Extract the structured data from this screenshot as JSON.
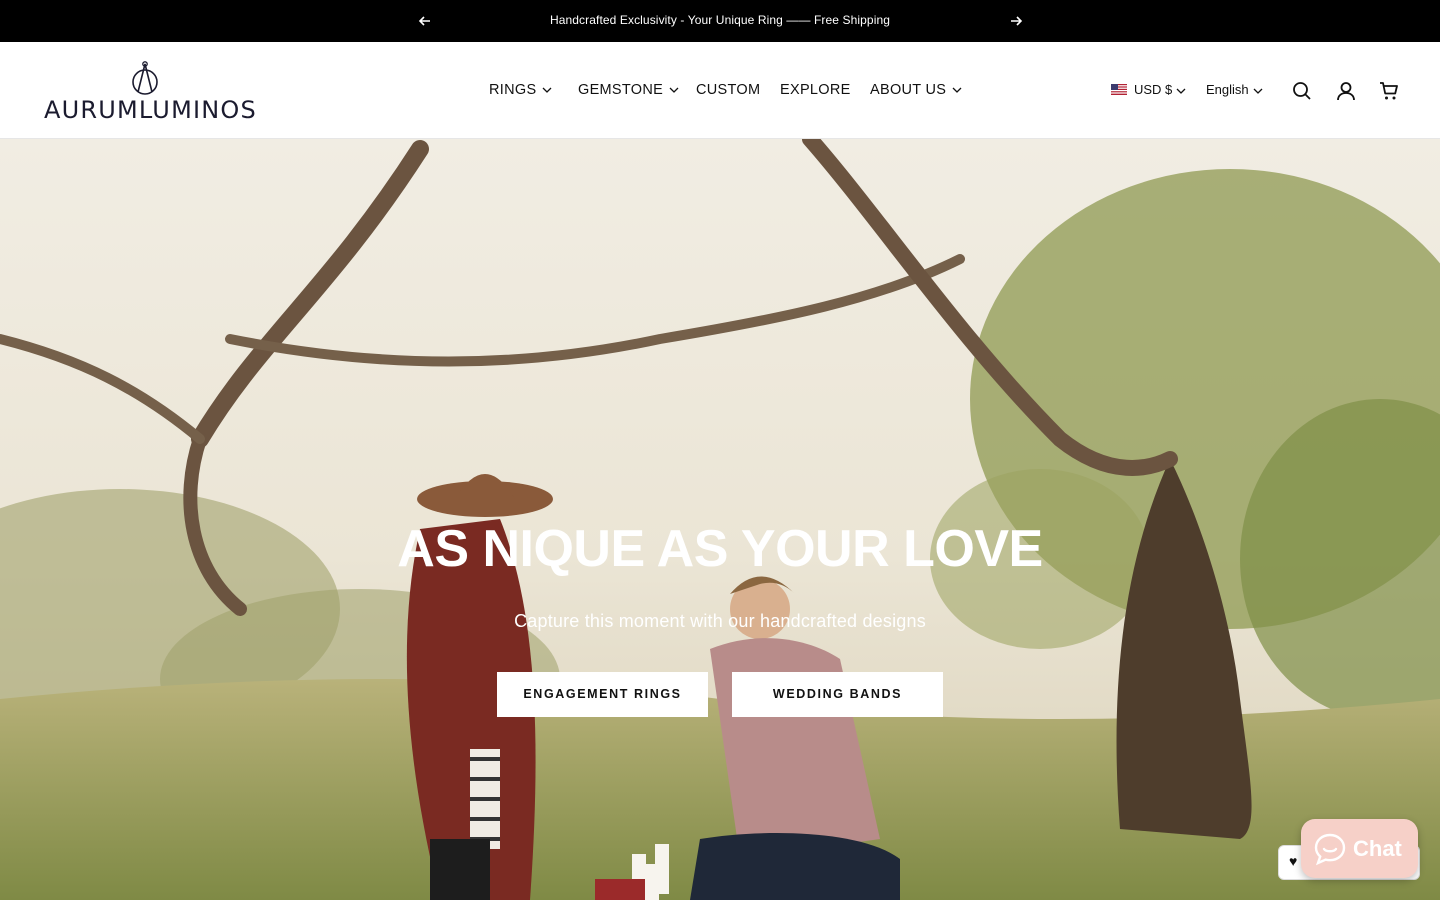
{
  "announcement": {
    "message": "Handcrafted Exclusivity - Your Unique Ring —— Free Shipping"
  },
  "header": {
    "logo_text": "AURUMLUMINOS",
    "nav": [
      {
        "label": "RINGS",
        "has_dropdown": true
      },
      {
        "label": "GEMSTONE",
        "has_dropdown": true
      },
      {
        "label": "CUSTOM",
        "has_dropdown": false
      },
      {
        "label": "EXPLORE",
        "has_dropdown": false
      },
      {
        "label": "ABOUT US",
        "has_dropdown": true
      }
    ],
    "currency": "USD $",
    "language": "English",
    "icons": [
      "search-icon",
      "account-icon",
      "cart-icon"
    ]
  },
  "hero": {
    "title": "AS NIQUE AS YOUR LOVE",
    "subtitle": "Capture this moment with our handcrafted designs",
    "buttons": [
      "ENGAGEMENT RINGS",
      "WEDDING BANDS"
    ]
  },
  "chat": {
    "label": "Chat"
  },
  "colors": {
    "announcement_bg": "#000000",
    "chat_bg": "#f6d0c8",
    "logo_text": "#1b1b2f"
  }
}
